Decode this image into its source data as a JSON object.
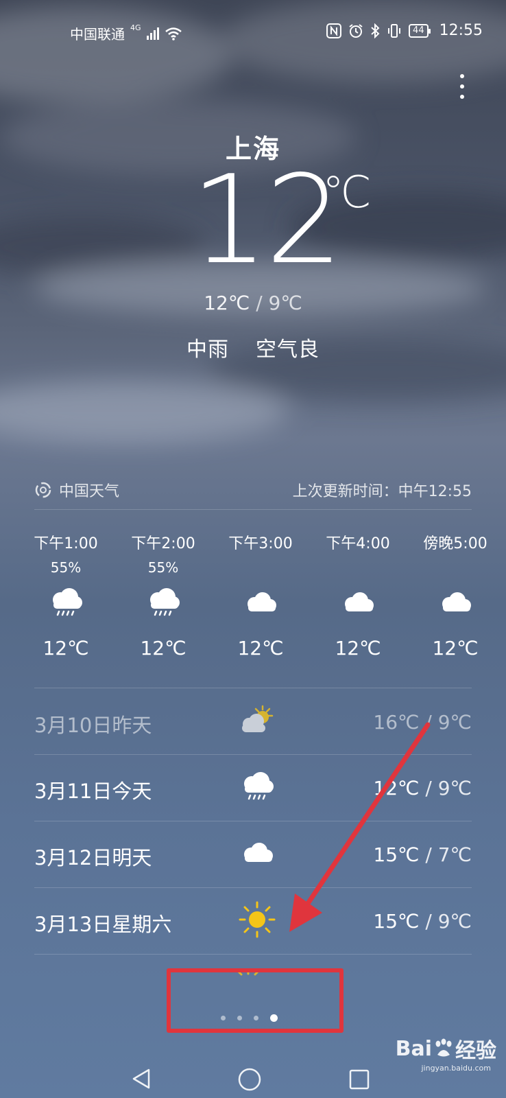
{
  "status_bar": {
    "carrier": "中国联通",
    "network": "4G",
    "battery": "44",
    "time": "12:55"
  },
  "weather": {
    "city": "上海",
    "temperature": "12",
    "unit": "℃",
    "high": "12℃",
    "low": "9℃",
    "condition": "中雨",
    "air_quality": "空气良"
  },
  "source": {
    "name": "中国天气",
    "update_label": "上次更新时间：中午12:55"
  },
  "hourly": [
    {
      "time": "下午1:00",
      "precip": "55%",
      "icon": "rain-cloud-icon",
      "temp": "12℃"
    },
    {
      "time": "下午2:00",
      "precip": "55%",
      "icon": "rain-cloud-icon",
      "temp": "12℃"
    },
    {
      "time": "下午3:00",
      "precip": "",
      "icon": "cloud-icon",
      "temp": "12℃"
    },
    {
      "time": "下午4:00",
      "precip": "",
      "icon": "cloud-icon",
      "temp": "12℃"
    },
    {
      "time": "傍晚5:00",
      "precip": "",
      "icon": "cloud-icon",
      "temp": "12℃"
    }
  ],
  "daily": [
    {
      "date": "3月10日昨天",
      "icon": "partly-cloudy-icon",
      "high": "16℃",
      "low": "9℃",
      "past": true
    },
    {
      "date": "3月11日今天",
      "icon": "rain-cloud-icon",
      "high": "12℃",
      "low": "9℃",
      "past": false
    },
    {
      "date": "3月12日明天",
      "icon": "cloud-icon",
      "high": "15℃",
      "low": "7℃",
      "past": false
    },
    {
      "date": "3月13日星期六",
      "icon": "sun-icon",
      "high": "15℃",
      "low": "9℃",
      "past": false
    }
  ],
  "pager": {
    "count": 4,
    "active_index": 3
  },
  "watermark": {
    "brand": "Bai",
    "brand2": "经验",
    "domain": "jingyan.baidu.com"
  },
  "colors": {
    "annotation": "#e0353d",
    "sun": "#f5c518"
  }
}
